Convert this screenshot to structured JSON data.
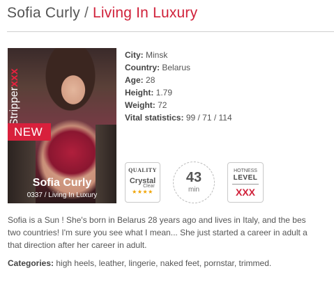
{
  "header": {
    "model_name": "Sofia Curly",
    "separator": "/",
    "scene_title": "Living In Luxury"
  },
  "poster": {
    "brand_text": "Stripper",
    "brand_suffix": "xxx",
    "new_badge": "NEW",
    "model_name": "Sofia Curly",
    "code_title": "0337 / Living In Luxury"
  },
  "details": {
    "city_label": "City:",
    "city": "Minsk",
    "country_label": "Country:",
    "country": "Belarus",
    "age_label": "Age:",
    "age": "28",
    "height_label": "Height:",
    "height": "1.79",
    "weight_label": "Weight:",
    "weight": "72",
    "vital_label": "Vital statistics:",
    "vital": "99 / 71 / 114"
  },
  "badges": {
    "quality_heading": "QUALITY",
    "quality_value": "Crystal",
    "quality_sub": "Clear",
    "quality_stars": "★★★★",
    "duration_value": "43",
    "duration_unit": "min",
    "hotness_heading": "HOTNESS",
    "hotness_level": "LEVEL",
    "hotness_value": "XXX"
  },
  "description": {
    "line1": "Sofia is a Sun ! She's born in Belarus 28 years ago and lives in Italy, and the bes",
    "line2": "two countries! I'm sure you see what I mean... She just started a career in adult a",
    "line3": "that direction after her career in adult."
  },
  "categories": {
    "label": "Categories:",
    "list": "high heels, leather, lingerie, naked feet, pornstar, trimmed."
  },
  "colors": {
    "accent": "#d0213a",
    "text": "#555555"
  }
}
